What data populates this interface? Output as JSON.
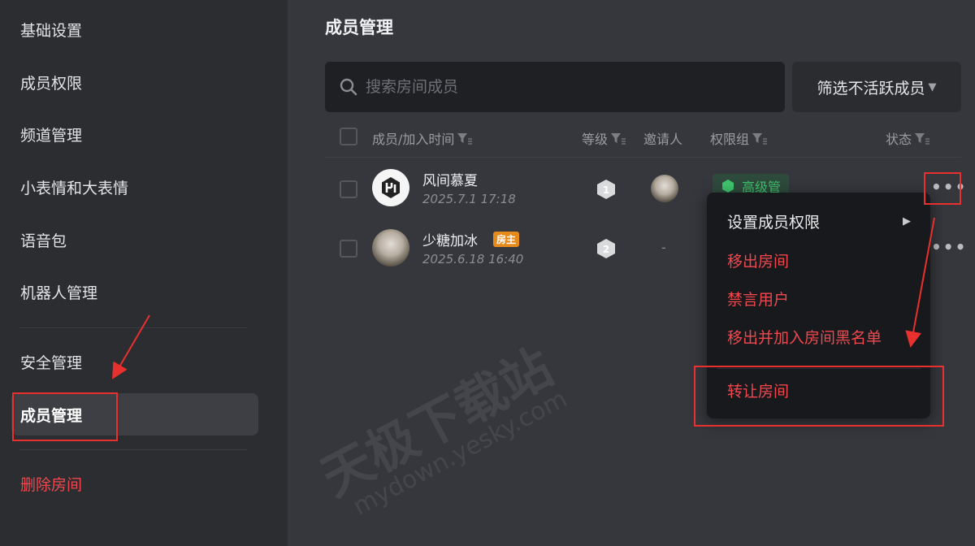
{
  "sidebar": {
    "items": [
      {
        "label": "基础设置"
      },
      {
        "label": "成员权限"
      },
      {
        "label": "频道管理"
      },
      {
        "label": "小表情和大表情"
      },
      {
        "label": "语音包"
      },
      {
        "label": "机器人管理"
      },
      {
        "label": "安全管理"
      },
      {
        "label": "成员管理"
      },
      {
        "label": "删除房间"
      }
    ]
  },
  "main": {
    "title": "成员管理",
    "search": {
      "placeholder": "搜索房间成员",
      "value": ""
    },
    "filter_label": "筛选不活跃成员",
    "columns": {
      "member": "成员/加入时间",
      "level": "等级",
      "inviter": "邀请人",
      "group": "权限组",
      "status": "状态"
    },
    "rows": [
      {
        "name": "风间慕夏",
        "time": "2025.7.1 17:18",
        "level": "1",
        "group": "高级管"
      },
      {
        "name": "少糖加冰",
        "badge": "房主",
        "time": "2025.6.18 16:40",
        "level": "2",
        "inviter": "-"
      }
    ]
  },
  "menu": {
    "items": [
      {
        "label": "设置成员权限"
      },
      {
        "label": "移出房间"
      },
      {
        "label": "禁言用户"
      },
      {
        "label": "移出并加入房间黑名单"
      },
      {
        "label": "转让房间"
      }
    ]
  },
  "watermark": {
    "text": "天极下载站",
    "url": "mydown.yesky.com"
  },
  "colors": {
    "accent_red": "#f0484e",
    "annotation_red": "#e8312f",
    "perm_green": "#3ec46d",
    "owner_orange": "#e68a1c"
  }
}
